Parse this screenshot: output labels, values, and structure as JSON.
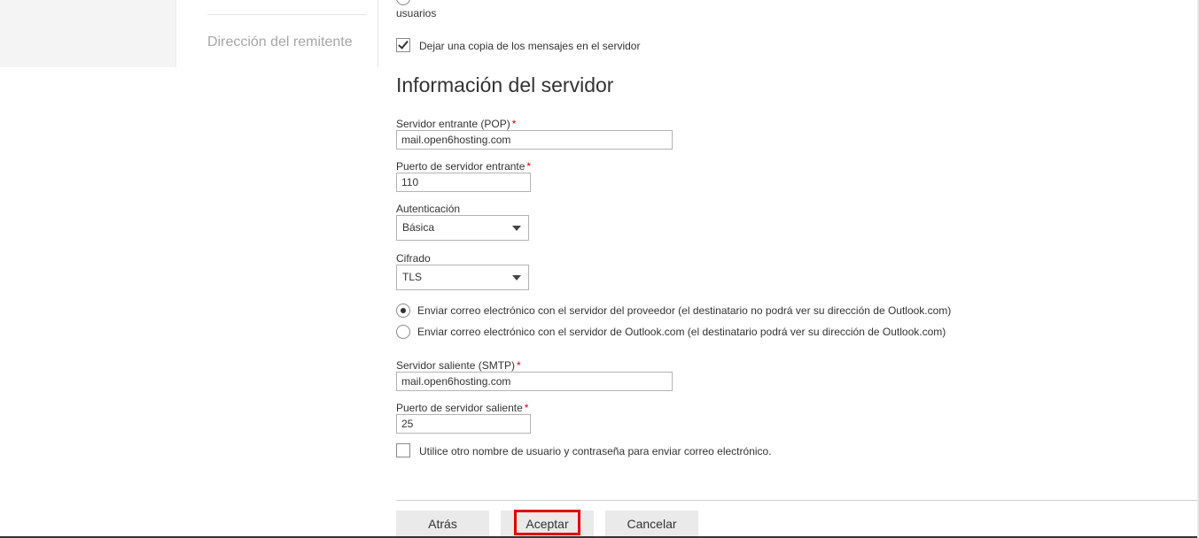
{
  "sidebar": {
    "nav_item": "Dirección del remitente"
  },
  "top_options": {
    "partial_radio_text": "",
    "partial_radio_text_line2": "usuarios",
    "keep_copy_label": "Dejar una copia de los mensajes en el servidor",
    "keep_copy_checked": true
  },
  "server_info": {
    "title": "Información del servidor",
    "incoming_server_label": "Servidor entrante (POP)",
    "incoming_server_value": "mail.open6hosting.com",
    "incoming_port_label": "Puerto de servidor entrante",
    "incoming_port_value": "110",
    "auth_label": "Autenticación",
    "auth_value": "Básica",
    "encryption_label": "Cifrado",
    "encryption_value": "TLS",
    "required_mark": "*",
    "send_option_provider": "Enviar correo electrónico con el servidor del proveedor (el destinatario no podrá ver su dirección de Outlook.com)",
    "send_option_outlook": "Enviar correo electrónico con el servidor de Outlook.com (el destinatario podrá ver su dirección de Outlook.com)",
    "selected_send_option": "provider",
    "outgoing_server_label": "Servidor saliente (SMTP)",
    "outgoing_server_value": "mail.open6hosting.com",
    "outgoing_port_label": "Puerto de servidor saliente",
    "outgoing_port_value": "25",
    "other_credentials_label": "Utilice otro nombre de usuario y contraseña para enviar correo electrónico.",
    "other_credentials_checked": false
  },
  "footer": {
    "back_label": "Atrás",
    "accept_label": "Aceptar",
    "cancel_label": "Cancelar",
    "highlight_color": "#e00000"
  }
}
